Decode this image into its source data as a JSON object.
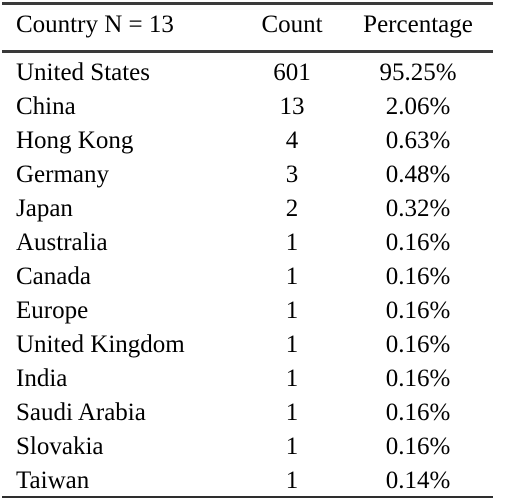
{
  "table": {
    "columns": [
      {
        "key": "country",
        "label": "Country N = 13",
        "align": "left"
      },
      {
        "key": "count",
        "label": "Count",
        "align": "center"
      },
      {
        "key": "percentage",
        "label": "Percentage",
        "align": "center"
      }
    ],
    "rows": [
      {
        "country": "United States",
        "count": "601",
        "percentage": "95.25%"
      },
      {
        "country": "China",
        "count": "13",
        "percentage": "2.06%"
      },
      {
        "country": "Hong Kong",
        "count": "4",
        "percentage": "0.63%"
      },
      {
        "country": "Germany",
        "count": "3",
        "percentage": "0.48%"
      },
      {
        "country": "Japan",
        "count": "2",
        "percentage": "0.32%"
      },
      {
        "country": "Australia",
        "count": "1",
        "percentage": "0.16%"
      },
      {
        "country": "Canada",
        "count": "1",
        "percentage": "0.16%"
      },
      {
        "country": "Europe",
        "count": "1",
        "percentage": "0.16%"
      },
      {
        "country": "United Kingdom",
        "count": "1",
        "percentage": "0.16%"
      },
      {
        "country": "India",
        "count": "1",
        "percentage": "0.16%"
      },
      {
        "country": "Saudi Arabia",
        "count": "1",
        "percentage": "0.16%"
      },
      {
        "country": "Slovakia",
        "count": "1",
        "percentage": "0.16%"
      },
      {
        "country": "Taiwan",
        "count": "1",
        "percentage": "0.14%"
      }
    ]
  },
  "chart_data": {
    "type": "table",
    "title": "Country N = 13",
    "columns": [
      "Country N = 13",
      "Count",
      "Percentage"
    ],
    "categories": [
      "United States",
      "China",
      "Hong Kong",
      "Germany",
      "Japan",
      "Australia",
      "Canada",
      "Europe",
      "United Kingdom",
      "India",
      "Saudi Arabia",
      "Slovakia",
      "Taiwan"
    ],
    "series": [
      {
        "name": "Count",
        "values": [
          601,
          13,
          4,
          3,
          2,
          1,
          1,
          1,
          1,
          1,
          1,
          1,
          1
        ]
      },
      {
        "name": "Percentage",
        "values": [
          95.25,
          2.06,
          0.63,
          0.48,
          0.32,
          0.16,
          0.16,
          0.16,
          0.16,
          0.16,
          0.16,
          0.16,
          0.14
        ]
      }
    ]
  },
  "style": {
    "rule_color": "#3a3a3a",
    "text_color": "#000000",
    "background": "#ffffff"
  }
}
